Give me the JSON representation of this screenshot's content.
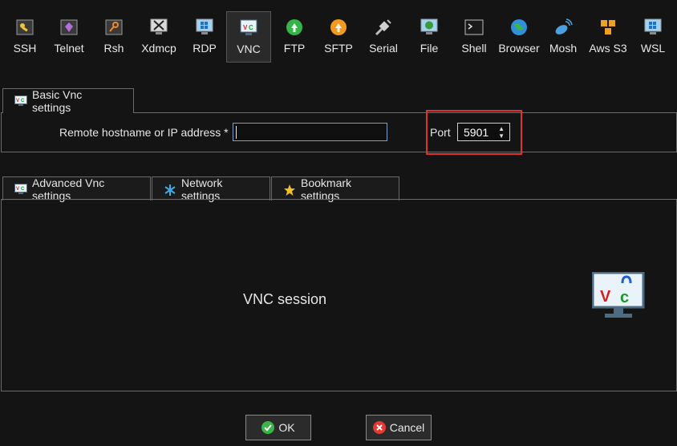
{
  "toolbar": {
    "items": [
      {
        "label": "SSH",
        "icon": "key-icon"
      },
      {
        "label": "Telnet",
        "icon": "telnet-icon"
      },
      {
        "label": "Rsh",
        "icon": "rsh-icon"
      },
      {
        "label": "Xdmcp",
        "icon": "xdmcp-icon"
      },
      {
        "label": "RDP",
        "icon": "rdp-icon"
      },
      {
        "label": "VNC",
        "icon": "vnc-icon",
        "active": true
      },
      {
        "label": "FTP",
        "icon": "ftp-icon"
      },
      {
        "label": "SFTP",
        "icon": "sftp-icon"
      },
      {
        "label": "Serial",
        "icon": "serial-icon"
      },
      {
        "label": "File",
        "icon": "file-icon"
      },
      {
        "label": "Shell",
        "icon": "shell-icon"
      },
      {
        "label": "Browser",
        "icon": "browser-icon"
      },
      {
        "label": "Mosh",
        "icon": "mosh-icon"
      },
      {
        "label": "Aws S3",
        "icon": "aws-s3-icon"
      },
      {
        "label": "WSL",
        "icon": "wsl-icon"
      }
    ]
  },
  "basic": {
    "tab_label": "Basic Vnc settings",
    "hostname_label": "Remote hostname or IP address *",
    "hostname_value": "",
    "port_label": "Port",
    "port_value": "5901"
  },
  "lower_tabs": [
    {
      "label": "Advanced Vnc settings"
    },
    {
      "label": "Network settings"
    },
    {
      "label": "Bookmark settings"
    }
  ],
  "session": {
    "title": "VNC session",
    "icon_letters": {
      "v": "V",
      "n": "ᴜ",
      "c": "c"
    }
  },
  "buttons": {
    "ok": "OK",
    "cancel": "Cancel"
  },
  "colors": {
    "highlight": "#e0322e",
    "background": "#141414"
  }
}
